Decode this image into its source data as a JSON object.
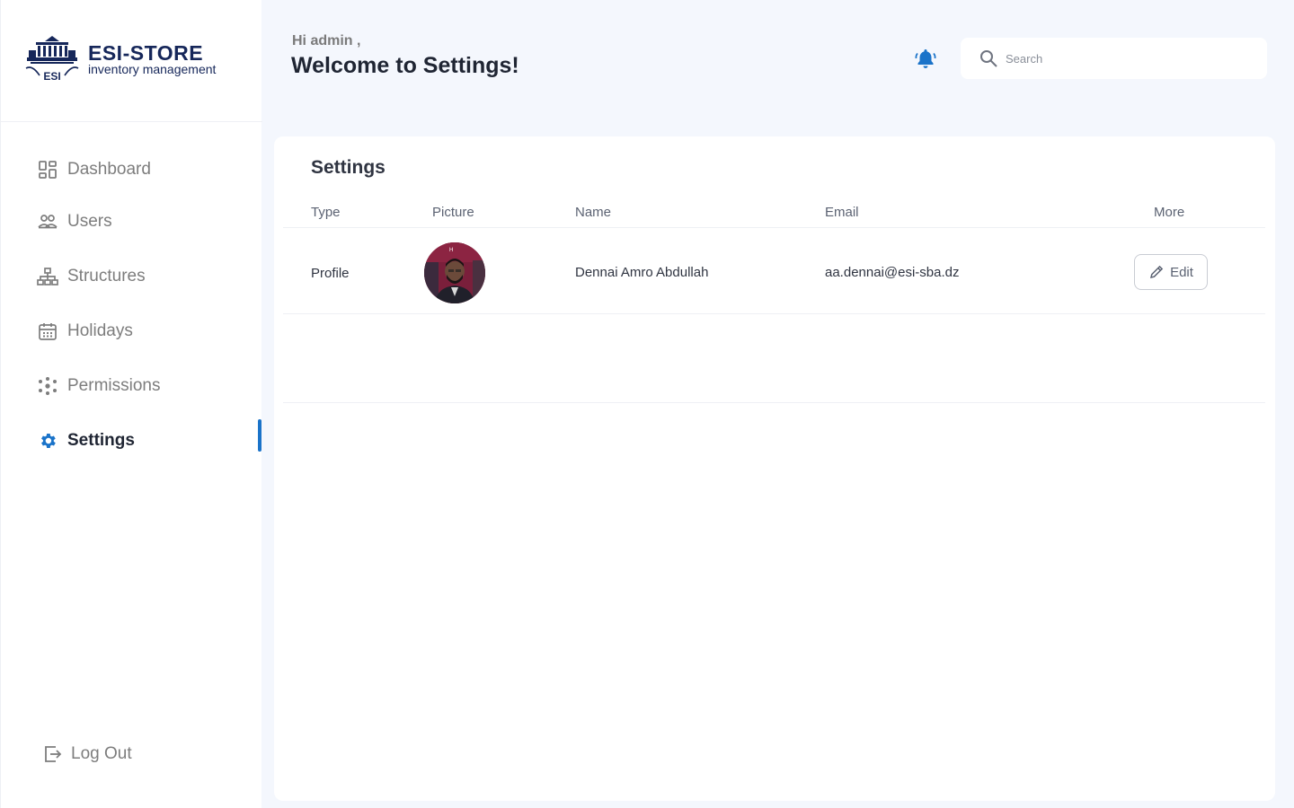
{
  "brand": {
    "title": "ESI-STORE",
    "subtitle": "inventory management",
    "logo_text": "ESI"
  },
  "sidebar": {
    "items": [
      {
        "label": "Dashboard",
        "icon": "dashboard-grid-icon"
      },
      {
        "label": "Users",
        "icon": "users-icon"
      },
      {
        "label": "Structures",
        "icon": "hierarchy-icon"
      },
      {
        "label": "Holidays",
        "icon": "calendar-icon"
      },
      {
        "label": "Permissions",
        "icon": "sparkle-icon"
      },
      {
        "label": "Settings",
        "icon": "gear-icon",
        "active": true
      }
    ],
    "logout_label": "Log Out"
  },
  "header": {
    "greeting": "Hi admin ,",
    "title": "Welcome to Settings!"
  },
  "search": {
    "placeholder": "Search",
    "value": ""
  },
  "main": {
    "title": "Settings",
    "columns": [
      "Type",
      "Picture",
      "Name",
      "Email",
      "More"
    ],
    "rows": [
      {
        "type": "Profile",
        "name": "Dennai Amro Abdullah",
        "email": "aa.dennai@esi-sba.dz",
        "action_label": "Edit"
      }
    ]
  },
  "colors": {
    "accent": "#1a73c9",
    "brand": "#16275a",
    "background": "#f4f7fd"
  }
}
